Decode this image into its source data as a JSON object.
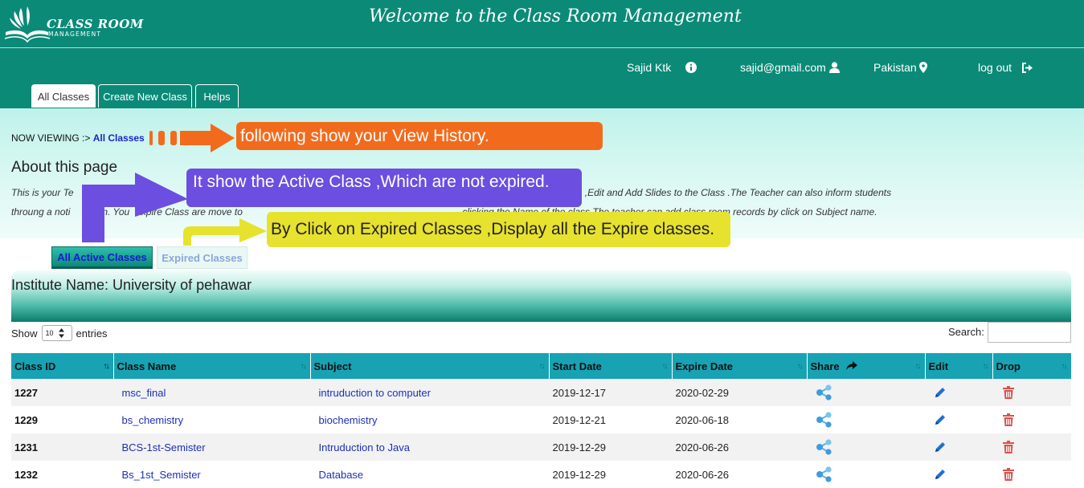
{
  "header": {
    "logo_line1": "CLASS ROOM",
    "logo_line2": "MANAGEMENT",
    "welcome": "Welcome to the Class Room Management"
  },
  "nav": {
    "user_name": "Sajid Ktk",
    "email": "sajid@gmail.com",
    "country": "Pakistan",
    "logout": "log out"
  },
  "tabs": [
    "All Classes",
    "Create New Class",
    "Helps"
  ],
  "breadcrumb": {
    "prefix": "NOW VIEWING :>",
    "current": "All Classes"
  },
  "about": {
    "title": "About this page",
    "text_line1": "This is your Te                The                                                                                                                          date. You can also Add,Drop ,Edit and Add Slides to the Class .The Teacher can also inform students",
    "text_line2": "throung a noti          on. You  Expire Class are move to                                                                                  clicking the Name of the class.The teacher can add class room records by click on Subject name."
  },
  "callouts": {
    "history": "following show your View History.",
    "active": "It show the Active Class ,Which are not expired.",
    "expired": "By Click on Expired Classes ,Display all the Expire classes."
  },
  "class_tabs": {
    "active": "All Active Classes",
    "expired": "Expired Classes"
  },
  "institute": "Institute Name: University of pehawar",
  "table_controls": {
    "show": "Show",
    "entries_value": "10",
    "entries": "entries",
    "search_label": "Search:"
  },
  "table": {
    "headers": [
      "Class ID",
      "Class Name",
      "Subject",
      "Start Date",
      "Expire Date",
      "Share",
      "Edit",
      "Drop"
    ],
    "rows": [
      {
        "id": "1227",
        "name": "msc_final",
        "subject": "intruduction to computer",
        "start": "2019-12-17",
        "expire": "2020-02-29"
      },
      {
        "id": "1229",
        "name": "bs_chemistry",
        "subject": "biochemistry",
        "start": "2019-12-21",
        "expire": "2020-06-18"
      },
      {
        "id": "1231",
        "name": "BCS-1st-Semister",
        "subject": "Intruduction to Java",
        "start": "2019-12-29",
        "expire": "2020-06-26"
      },
      {
        "id": "1232",
        "name": "Bs_1st_Semister",
        "subject": "Database",
        "start": "2019-12-29",
        "expire": "2020-06-26"
      }
    ]
  },
  "colors": {
    "brand_teal": "#0b8a78",
    "table_header": "#17a3b3",
    "orange_callout": "#f26b1d",
    "purple_callout": "#6c4ee0",
    "yellow_callout": "#e6e22e"
  },
  "icons": [
    "info-icon",
    "user-icon",
    "map-marker-icon",
    "sign-out-icon",
    "share-icon",
    "edit-pencil-icon",
    "trash-icon",
    "sort-icon"
  ]
}
